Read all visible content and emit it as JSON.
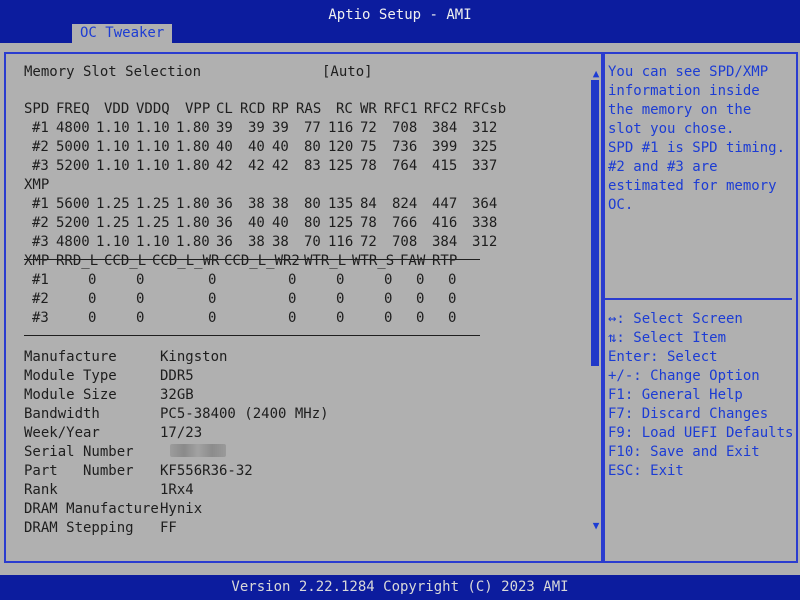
{
  "header": {
    "title": "Aptio Setup - AMI",
    "tab": "OC Tweaker"
  },
  "setting": {
    "label": "Memory Slot Selection",
    "value": "[Auto]"
  },
  "spd": {
    "headers": [
      "SPD",
      "FREQ",
      "VDD",
      "VDDQ",
      "VPP",
      "CL",
      "RCD",
      "RP",
      "RAS",
      "RC",
      "WR",
      "RFC1",
      "RFC2",
      "RFCsb"
    ],
    "rows": [
      [
        "#1",
        "4800",
        "1.10",
        "1.10",
        "1.80",
        "39",
        "39",
        "39",
        "77",
        "116",
        "72",
        "708",
        "384",
        "312"
      ],
      [
        "#2",
        "5000",
        "1.10",
        "1.10",
        "1.80",
        "40",
        "40",
        "40",
        "80",
        "120",
        "75",
        "736",
        "399",
        "325"
      ],
      [
        "#3",
        "5200",
        "1.10",
        "1.10",
        "1.80",
        "42",
        "42",
        "42",
        "83",
        "125",
        "78",
        "764",
        "415",
        "337"
      ]
    ]
  },
  "xmp": {
    "label": "XMP",
    "rows": [
      [
        "#1",
        "5600",
        "1.25",
        "1.25",
        "1.80",
        "36",
        "38",
        "38",
        "80",
        "135",
        "84",
        "824",
        "447",
        "364"
      ],
      [
        "#2",
        "5200",
        "1.25",
        "1.25",
        "1.80",
        "36",
        "40",
        "40",
        "80",
        "125",
        "78",
        "766",
        "416",
        "338"
      ],
      [
        "#3",
        "4800",
        "1.10",
        "1.10",
        "1.80",
        "36",
        "38",
        "38",
        "70",
        "116",
        "72",
        "708",
        "384",
        "312"
      ]
    ]
  },
  "xmp2": {
    "headers": [
      "XMP",
      "RRD_L",
      "CCD_L",
      "CCD_L_WR",
      "CCD_L_WR2",
      "WTR_L",
      "WTR_S",
      "FAW",
      "RTP"
    ],
    "rows": [
      [
        "#1",
        "0",
        "0",
        "0",
        "0",
        "0",
        "0",
        "0",
        "0"
      ],
      [
        "#2",
        "0",
        "0",
        "0",
        "0",
        "0",
        "0",
        "0",
        "0"
      ],
      [
        "#3",
        "0",
        "0",
        "0",
        "0",
        "0",
        "0",
        "0",
        "0"
      ]
    ]
  },
  "module": [
    {
      "label": "Manufacture",
      "value": "Kingston"
    },
    {
      "label": "Module Type",
      "value": "DDR5"
    },
    {
      "label": "Module Size",
      "value": "32GB"
    },
    {
      "label": "Bandwidth",
      "value": "PC5-38400 (2400 MHz)"
    },
    {
      "label": "Week/Year",
      "value": "17/23"
    },
    {
      "label": "Serial Number",
      "value": ""
    },
    {
      "label": "Part   Number",
      "value": "KF556R36-32"
    },
    {
      "label": "Rank",
      "value": "1Rx4"
    },
    {
      "label": "DRAM Manufacture",
      "value": "Hynix"
    },
    {
      "label": "DRAM Stepping",
      "value": "FF"
    }
  ],
  "help": {
    "description": [
      "You can see SPD/XMP",
      "information inside",
      "the memory on the",
      "slot you chose.",
      "SPD #1 is SPD timing.",
      "#2 and #3 are",
      "estimated for memory",
      "OC."
    ],
    "keys": [
      "↔: Select Screen",
      "⇅: Select Item",
      "Enter: Select",
      "+/-: Change Option",
      "F1: General Help",
      "F7: Discard Changes",
      "F9: Load UEFI Defaults",
      "F10: Save and Exit",
      "ESC: Exit"
    ]
  },
  "footer": "Version 2.22.1284 Copyright (C) 2023 AMI",
  "colors": {
    "title_bar": "#0c1c9e",
    "body_bg": "#b0b0b0",
    "accent": "#1c3cd4",
    "text": "#1e1e1e"
  }
}
